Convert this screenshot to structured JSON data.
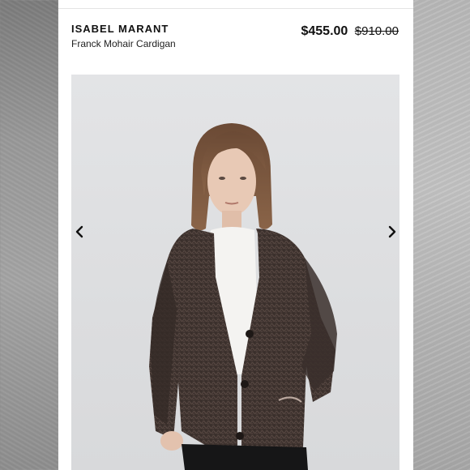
{
  "product": {
    "brand": "ISABEL MARANT",
    "name": "Franck Mohair Cardigan",
    "price": "$455.00",
    "original_price": "$910.00"
  },
  "gallery": {
    "prev_icon": "chevron-left-icon",
    "next_icon": "chevron-right-icon"
  },
  "colors": {
    "panel": "#ffffff",
    "text": "#111111",
    "photo_background": "#dedfe1",
    "cardigan": "#3b302c"
  }
}
